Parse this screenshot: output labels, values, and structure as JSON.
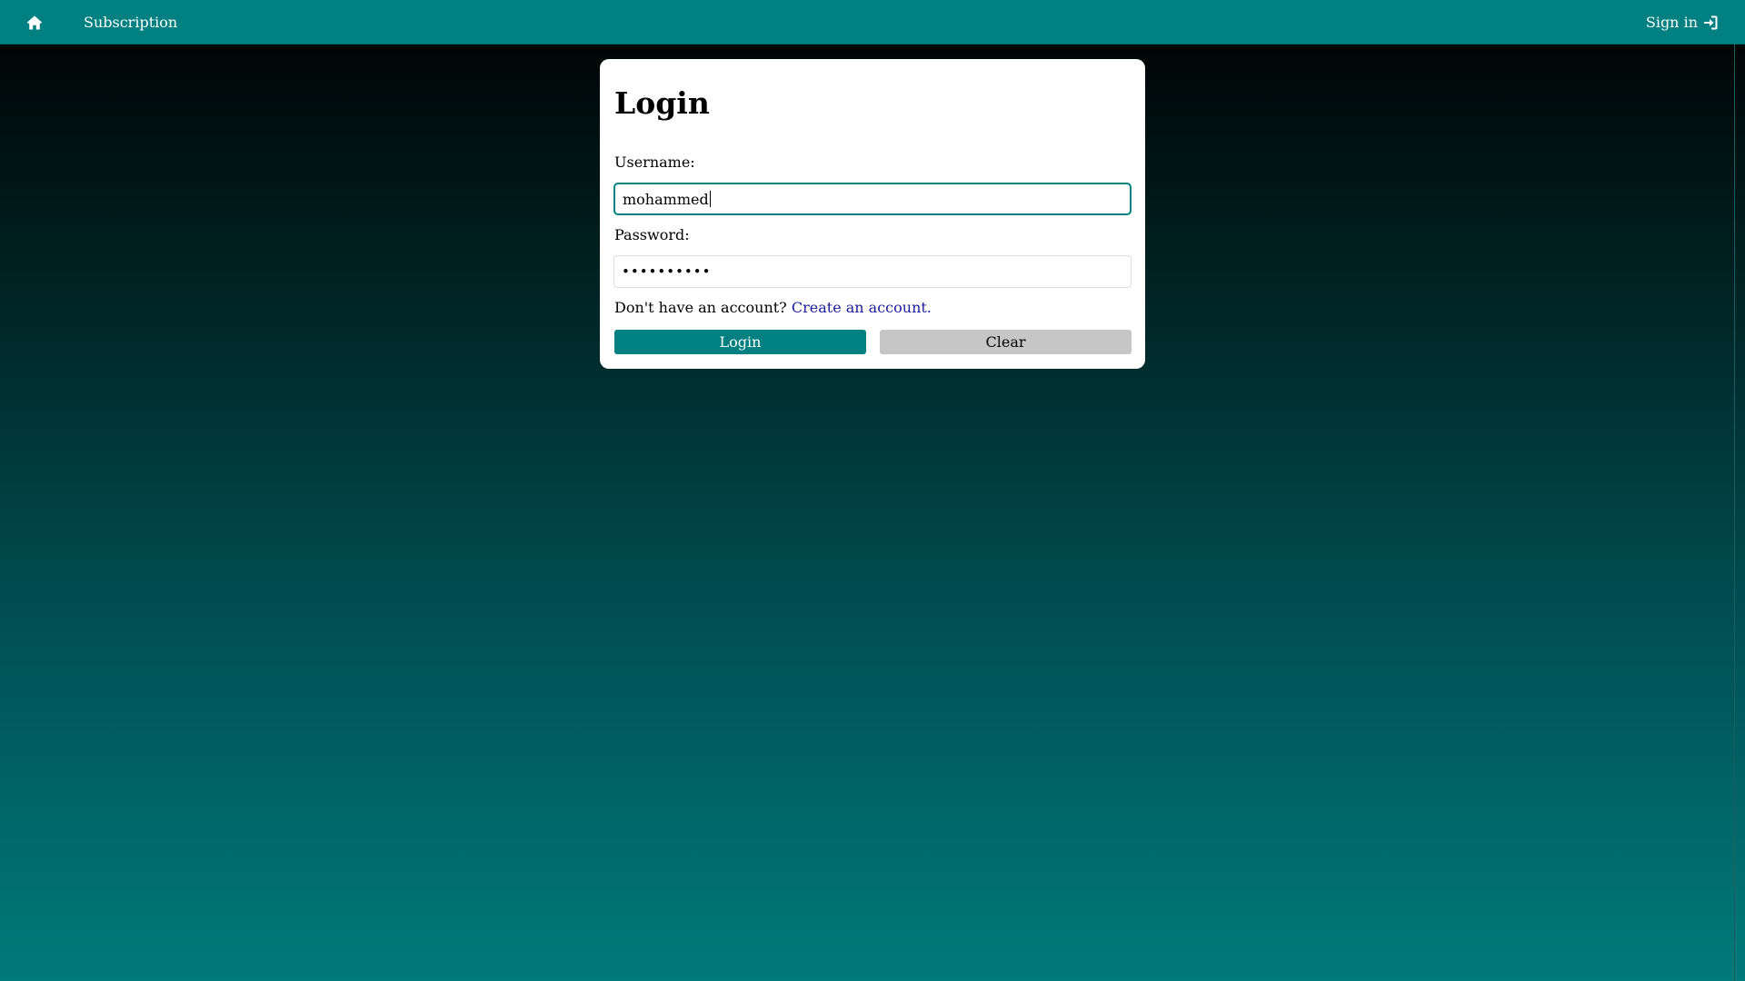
{
  "nav": {
    "home_icon": "home-icon",
    "subscription_label": "Subscription",
    "signin_label": "Sign in",
    "signin_icon": "sign-in-icon"
  },
  "login_form": {
    "title": "Login",
    "username_label": "Username:",
    "username_value": "mohammed",
    "password_label": "Password:",
    "password_masked": "••••••••••",
    "signup_prompt": "Don't have an account?",
    "signup_link": "Create an account.",
    "login_button": "Login",
    "clear_button": "Clear"
  },
  "colors": {
    "accent": "#008080",
    "link": "#1c1c9c",
    "clear_button": "#c6c6c6",
    "card": "#ffffff"
  }
}
